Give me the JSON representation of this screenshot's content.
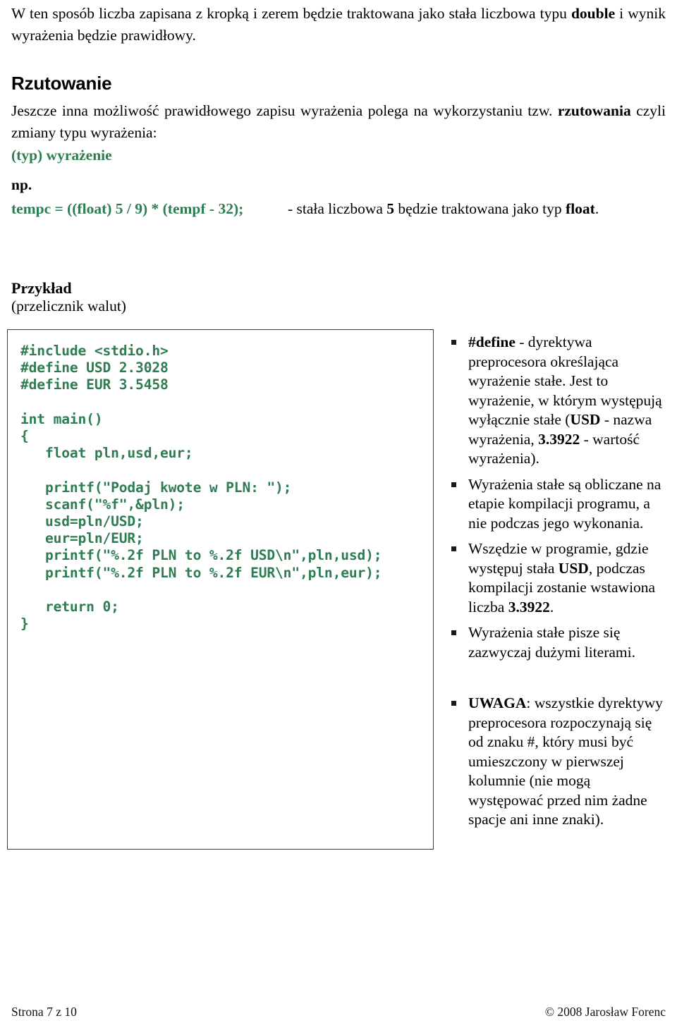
{
  "document": {
    "language": "pl",
    "page_background": "#ffffff",
    "accent_green": "#2E7D52",
    "text_color": "#000000"
  },
  "intro": {
    "text_before_bold": "W ten sposób liczba zapisana z kropką i zerem będzie traktowana jako stała liczbowa typu ",
    "bold_word": "double",
    "text_after_bold": " i wynik wyrażenia będzie prawidłowy."
  },
  "section": {
    "heading": "Rzutowanie",
    "paragraph_before_bold": "Jeszcze inna możliwość prawidłowego zapisu wyrażenia polega na wykorzystaniu tzw. ",
    "paragraph_bold": "rzutowania",
    "paragraph_after_bold": " czyli zmiany typu wyrażenia:",
    "cast_syntax": "(typ) wyrażenie",
    "np_label": "np.",
    "cast_example_code": "tempc = ((float) 5 / 9) * (tempf - 32);",
    "cast_note_before_bold1": "- stała liczbowa ",
    "cast_note_bold1": "5",
    "cast_note_middle": " będzie traktowana jako typ ",
    "cast_note_bold2": "float",
    "cast_note_after": "."
  },
  "example": {
    "heading": "Przykład",
    "subheading": "(przelicznik walut)",
    "code": "#include <stdio.h>\n#define USD 2.3028\n#define EUR 3.5458\n\nint main()\n{\n   float pln,usd,eur;\n\n   printf(\"Podaj kwote w PLN: \");\n   scanf(\"%f\",&pln);\n   usd=pln/USD;\n   eur=pln/EUR;\n   printf(\"%.2f PLN to %.2f USD\\n\",pln,usd);\n   printf(\"%.2f PLN to %.2f EUR\\n\",pln,eur);\n\n   return 0;\n}"
  },
  "notes": {
    "bullet_marker_icon": "square-bullet-icon",
    "items": [
      {
        "segments": [
          {
            "text": "#define",
            "bold": true
          },
          {
            "text": " - dyrektywa preprocesora określająca wyrażenie stałe. Jest to wyrażenie, w którym występują wyłącznie stałe (",
            "bold": false
          },
          {
            "text": "USD",
            "bold": true
          },
          {
            "text": " - nazwa wyrażenia, ",
            "bold": false
          },
          {
            "text": "3.3922",
            "bold": true
          },
          {
            "text": " - wartość wyrażenia).",
            "bold": false
          }
        ]
      },
      {
        "segments": [
          {
            "text": "Wyrażenia stałe są obliczane na etapie kompilacji programu, a nie podczas jego wykonania.",
            "bold": false
          }
        ]
      },
      {
        "segments": [
          {
            "text": "Wszędzie w programie, gdzie występuj stała ",
            "bold": false
          },
          {
            "text": "USD",
            "bold": true
          },
          {
            "text": ", podczas kompilacji zostanie wstawiona liczba ",
            "bold": false
          },
          {
            "text": "3.3922",
            "bold": true
          },
          {
            "text": ".",
            "bold": false
          }
        ]
      },
      {
        "segments": [
          {
            "text": "Wyrażenia stałe pisze się zazwyczaj dużymi literami.",
            "bold": false
          }
        ]
      }
    ]
  },
  "warning": {
    "bullet_marker_icon": "square-bullet-icon",
    "items": [
      {
        "segments": [
          {
            "text": "UWAGA",
            "bold": true
          },
          {
            "text": ": wszystkie dyrektywy preprocesora rozpoczynają się od znaku #, który musi być umieszczony w pierwszej kolumnie (nie mogą występować przed nim żadne spacje ani inne znaki).",
            "bold": false
          }
        ]
      }
    ]
  },
  "footer": {
    "page_indicator": "Strona 7 z 10",
    "copyright": "© 2008 Jarosław Forenc"
  }
}
